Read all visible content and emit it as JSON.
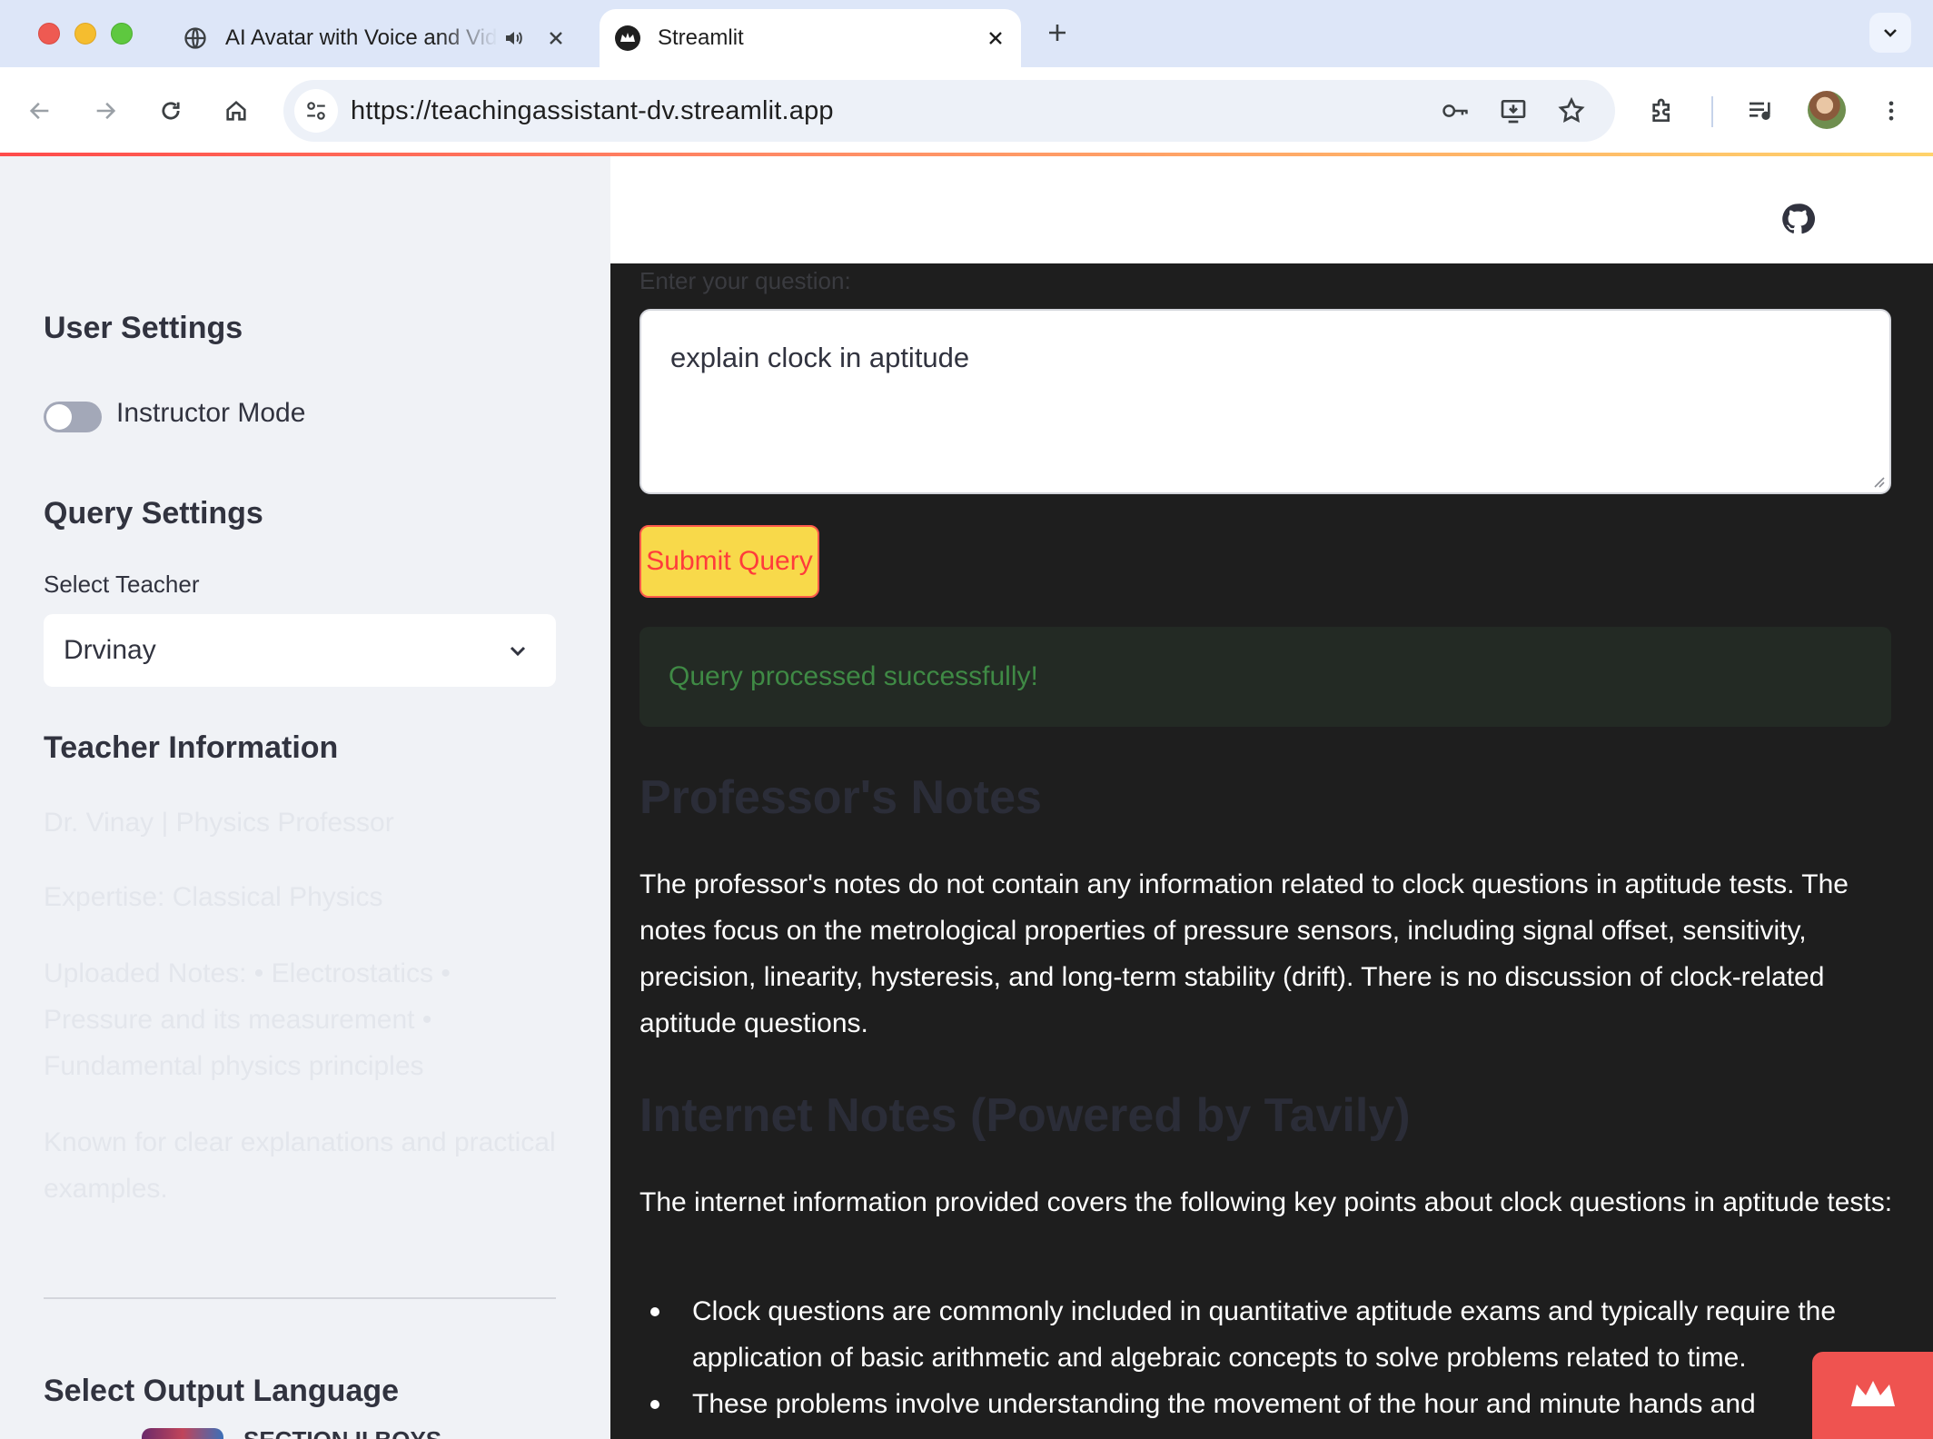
{
  "browser": {
    "tabs": [
      {
        "title": "AI Avatar with Voice and Video",
        "active": false,
        "audio": true
      },
      {
        "title": "Streamlit",
        "active": true,
        "audio": false
      }
    ],
    "url": "https://teachingassistant-dv.streamlit.app"
  },
  "sidebar": {
    "user_settings_heading": "User Settings",
    "instructor_mode_label": "Instructor Mode",
    "instructor_mode_on": false,
    "query_settings_heading": "Query Settings",
    "select_teacher_label": "Select Teacher",
    "select_teacher_value": "Drvinay",
    "teacher_info_heading": "Teacher Information",
    "teacher_info": [
      "Dr. Vinay | Physics Professor",
      "Expertise: Classical Physics",
      "Uploaded Notes: • Electrostatics • Pressure and its measurement • Fundamental physics principles",
      "Known for clear explanations and practical examples."
    ],
    "output_language_heading": "Select Output Language",
    "partial_item_label": "SECTION II BOYS"
  },
  "main": {
    "question_label": "Enter your question:",
    "question_value": "explain clock in aptitude",
    "submit_label": "Submit Query",
    "success_message": "Query processed successfully!",
    "professor_notes_heading": "Professor's Notes",
    "professor_notes_text": "The professor's notes do not contain any information related to clock questions in aptitude tests. The notes focus on the metrological properties of pressure sensors, including signal offset, sensitivity, precision, linearity, hysteresis, and long-term stability (drift). There is no discussion of clock-related aptitude questions.",
    "internet_notes_heading": "Internet Notes (Powered by Tavily)",
    "internet_notes_intro": "The internet information provided covers the following key points about clock questions in aptitude tests:",
    "internet_notes_bullets": [
      "Clock questions are commonly included in quantitative aptitude exams and typically require the application of basic arithmetic and algebraic concepts to solve problems related to time.",
      "These problems involve understanding the movement of the hour and minute hands and"
    ]
  },
  "colors": {
    "accent": "#ff4b4b",
    "button_bg": "#f8d94a",
    "success_text": "#3f8a45",
    "sidebar_bg": "#f0f2f6",
    "main_bg": "#1e1e1e"
  }
}
